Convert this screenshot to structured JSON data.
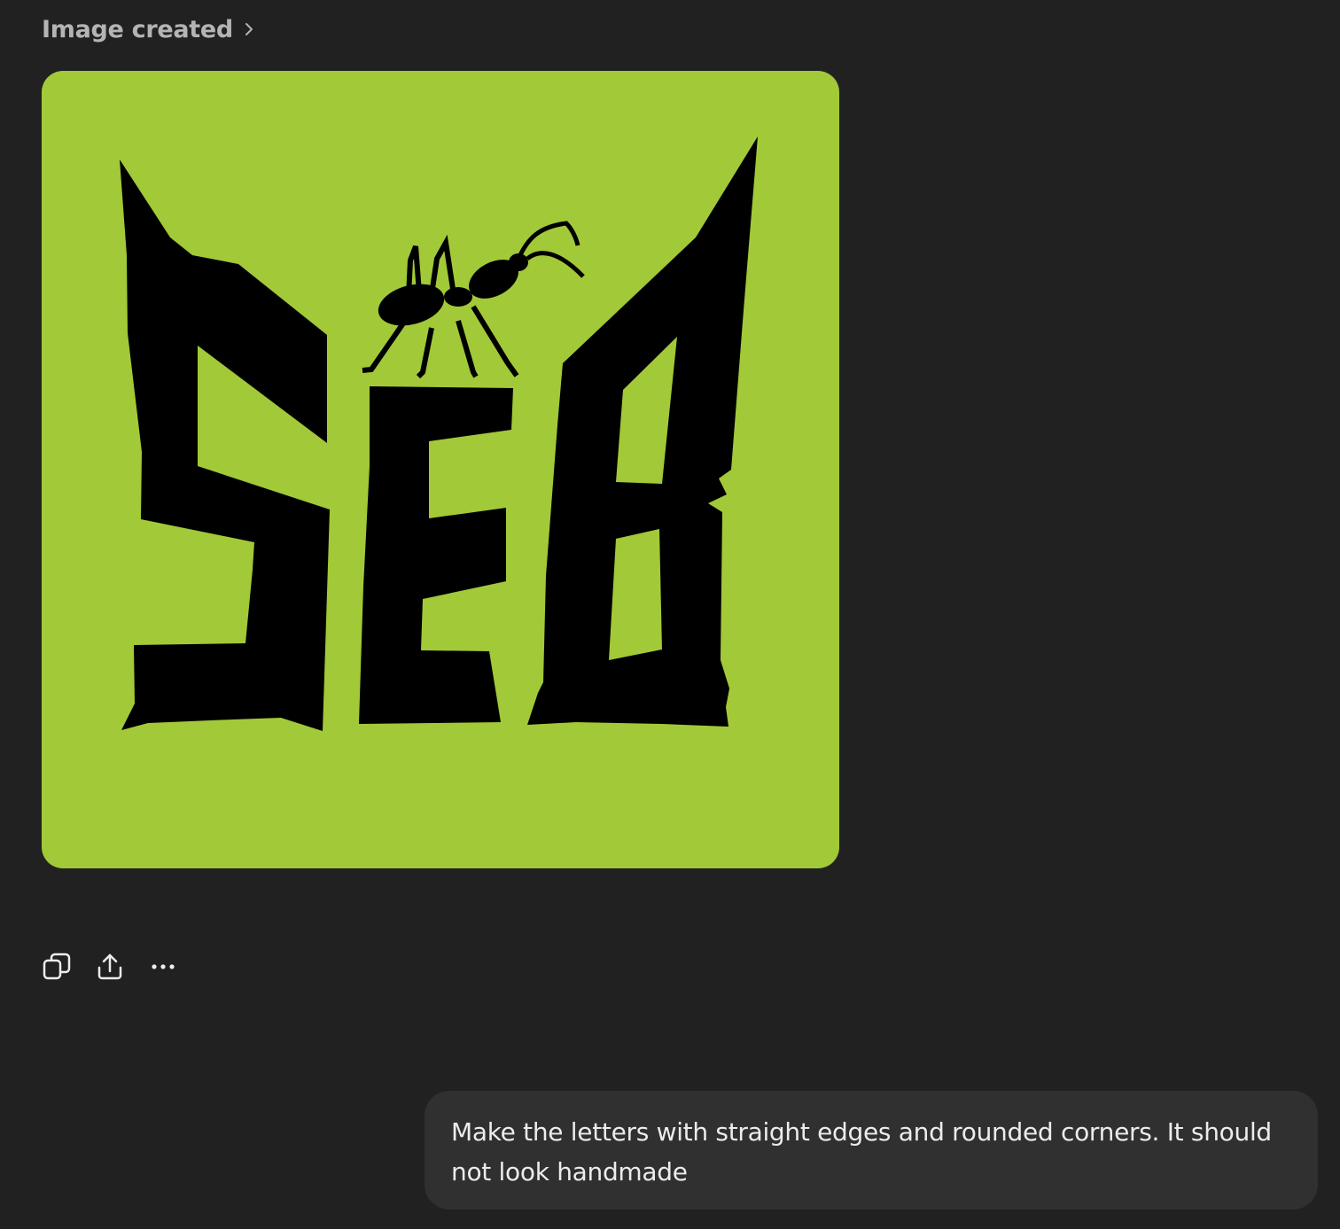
{
  "header": {
    "label": "Image created",
    "chevron_icon": "chevron-right-icon"
  },
  "generated_image": {
    "background_color": "#a2c938",
    "letter_color": "#000000",
    "logo_text": "SEB",
    "depicts": "ant-icon"
  },
  "actions": [
    {
      "name": "copy-button",
      "icon": "copy-icon"
    },
    {
      "name": "share-button",
      "icon": "share-icon"
    },
    {
      "name": "more-options-button",
      "icon": "more-dots-icon"
    }
  ],
  "user_message": {
    "text": "Make the letters with straight edges and rounded corners. It should not look handmade"
  },
  "colors": {
    "background": "#212121",
    "bubble": "#303030",
    "text": "#ececec",
    "muted_text": "#b4b4b4"
  }
}
